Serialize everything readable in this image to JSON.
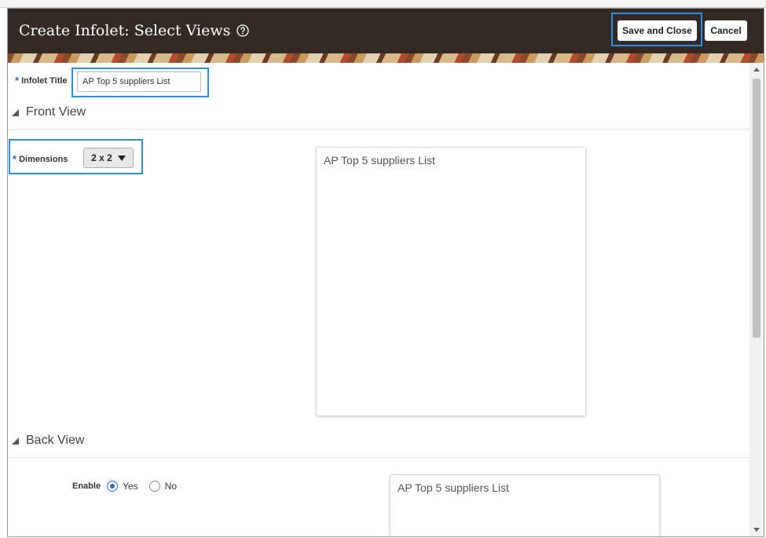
{
  "dialog": {
    "title": "Create Infolet: Select Views",
    "help_icon": "help-circle-icon",
    "save_label": "Save and Close",
    "cancel_label": "Cancel"
  },
  "infolet_title": {
    "label": "Infolet Title",
    "value": "AP Top 5 suppliers List"
  },
  "front_view": {
    "heading": "Front View",
    "dimensions_label": "Dimensions",
    "dimensions_value": "2 x 2",
    "preview_title": "AP Top 5 suppliers List"
  },
  "back_view": {
    "heading": "Back View",
    "enable_label": "Enable",
    "option_yes": "Yes",
    "option_no": "No",
    "selected": "Yes",
    "preview_title": "AP Top 5 suppliers List"
  },
  "colors": {
    "header_bg": "#332a24",
    "highlight": "#2a8de8",
    "required": "#1f66c7"
  }
}
